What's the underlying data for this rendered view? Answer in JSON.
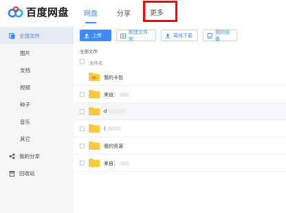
{
  "header": {
    "brand": "百度网盘",
    "tabs": [
      {
        "label": "网盘"
      },
      {
        "label": "分享"
      },
      {
        "label": "更多"
      }
    ]
  },
  "sidebar": {
    "items": [
      {
        "label": "全部文件"
      },
      {
        "label": "图片"
      },
      {
        "label": "文档"
      },
      {
        "label": "视频"
      },
      {
        "label": "种子"
      },
      {
        "label": "音乐"
      },
      {
        "label": "其它"
      },
      {
        "label": "我的分享"
      },
      {
        "label": "回收站"
      }
    ]
  },
  "toolbar": {
    "upload": "上传",
    "new_folder": "新建文件夹",
    "offline_download": "离线下载",
    "my_devices": "我的设备"
  },
  "breadcrumb": "全部文件",
  "list": {
    "header_name": "文件名",
    "rows": [
      {
        "name": "我的卡包"
      },
      {
        "name": "来自："
      },
      {
        "name": "d"
      },
      {
        "name": "("
      },
      {
        "name": "我的资源"
      },
      {
        "name": "来自："
      }
    ]
  },
  "colors": {
    "accent": "#3b8cff",
    "folder": "#ffc93e",
    "highlight_box": "#ff0000"
  }
}
